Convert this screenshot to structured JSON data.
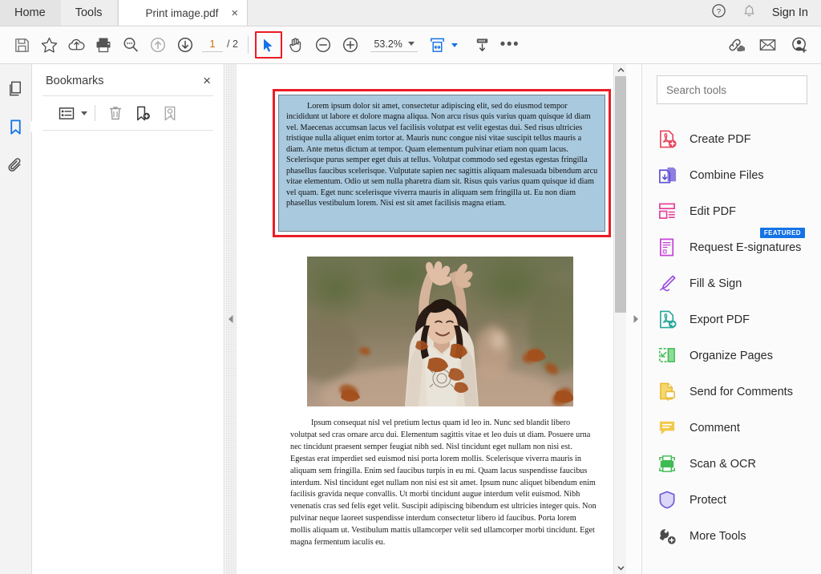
{
  "window": {
    "tabs": [
      {
        "label": "Home",
        "name": "home-tab"
      },
      {
        "label": "Tools",
        "name": "tools-tab"
      }
    ],
    "document_tab": {
      "title": "Print image.pdf",
      "close": "×"
    },
    "sign_in": "Sign In",
    "help_icon": "help-circle-icon",
    "bell_icon": "notification-bell-icon"
  },
  "toolbar": {
    "save_icon": "save-icon",
    "star_icon": "add-to-favorites-star-icon",
    "cloud_icon": "save-to-cloud-icon",
    "print_icon": "print-icon",
    "search_icon": "search-icon",
    "previous_icon": "previous-page-up-arrow-icon",
    "next_icon": "next-page-down-arrow-icon",
    "page_current": "1",
    "page_total": "/ 2",
    "select_tool_icon": "select-cursor-icon",
    "hand_tool_icon": "hand-pan-icon",
    "zoom_out_icon": "zoom-out-minus-icon",
    "zoom_in_icon": "zoom-in-plus-icon",
    "zoom_level": "53.2%",
    "fit_page_icon": "fit-page-width-icon",
    "scroll_mode_icon": "page-display-scroll-icon",
    "more_icon": "more-options-ellipsis-icon",
    "share_link_icon": "share-link-cloud-icon",
    "email_icon": "email-envelope-icon",
    "add_person_icon": "add-person-icon"
  },
  "rail": {
    "items": [
      {
        "name": "page-thumbnails-icon",
        "label": "Page Thumbnails",
        "active": false
      },
      {
        "name": "bookmarks-icon",
        "label": "Bookmarks",
        "active": true
      },
      {
        "name": "attachments-paperclip-icon",
        "label": "Attachments",
        "active": false
      }
    ]
  },
  "bookmarks": {
    "title": "Bookmarks",
    "close_label": "×",
    "tools": [
      {
        "name": "bookmark-options-list-icon",
        "label": "Options"
      },
      {
        "name": "delete-trash-icon",
        "label": "Delete Bookmark"
      },
      {
        "name": "new-bookmark-icon",
        "label": "New Bookmark"
      },
      {
        "name": "find-bookmark-icon",
        "label": "Find Bookmark"
      }
    ]
  },
  "document": {
    "selected_paragraph": "Lorem ipsum dolor sit amet, consectetur adipiscing elit, sed do eiusmod tempor incididunt ut labore et dolore magna aliqua. Non arcu risus quis varius quam quisque id diam vel. Maecenas accumsan lacus vel facilisis volutpat est velit egestas dui. Sed risus ultricies tristique nulla aliquet enim tortor at. Mauris nunc congue nisi vitae suscipit tellus mauris a diam. Ante metus dictum at tempor. Quam elementum pulvinar etiam non quam lacus. Scelerisque purus semper eget duis at tellus. Volutpat commodo sed egestas egestas fringilla phasellus faucibus scelerisque. Vulputate sapien nec sagittis aliquam malesuada bibendum arcu vitae elementum. Odio ut sem nulla pharetra diam sit. Risus quis varius quam quisque id diam vel quam. Eget nunc scelerisque viverra mauris in aliquam sem fringilla ut. Eu non diam phasellus vestibulum lorem. Nisi est sit amet facilisis magna etiam.",
    "body_paragraph": "Ipsum consequat nisl vel pretium lectus quam id leo in. Nunc sed blandit libero volutpat sed cras ornare arcu dui. Elementum sagittis vitae et leo duis ut diam. Posuere urna nec tincidunt praesent semper feugiat nibh sed. Nisl tincidunt eget nullam non nisi est. Egestas erat imperdiet sed euismod nisi porta lorem mollis. Scelerisque viverra mauris in aliquam sem fringilla. Enim sed faucibus turpis in eu mi. Quam lacus suspendisse faucibus interdum. Nisl tincidunt eget nullam non nisi est sit amet. Ipsum nunc aliquet bibendum enim facilisis gravida neque convallis. Ut morbi tincidunt augue interdum velit euismod. Nibh venenatis cras sed felis eget velit. Suscipit adipiscing bibendum est ultricies integer quis. Non pulvinar neque laoreet suspendisse interdum consectetur libero id faucibus. Porta lorem mollis aliquam ut. Vestibulum mattis ullamcorper velit sed ullamcorper morbi tincidunt. Eget magna fermentum iaculis eu.",
    "image_alt": "woman-with-raised-arms-in-autumn-leaves-photo",
    "selection_border_color": "#ec1c24",
    "selection_highlight_color": "#a9c9de"
  },
  "tools_panel": {
    "search_placeholder": "Search tools",
    "items": [
      {
        "label": "Create PDF",
        "icon": "create-pdf-icon",
        "badge": ""
      },
      {
        "label": "Combine Files",
        "icon": "combine-files-icon",
        "badge": ""
      },
      {
        "label": "Edit PDF",
        "icon": "edit-pdf-icon",
        "badge": ""
      },
      {
        "label": "Request E-signatures",
        "icon": "request-e-signatures-icon",
        "badge": "FEATURED"
      },
      {
        "label": "Fill & Sign",
        "icon": "fill-and-sign-icon",
        "badge": ""
      },
      {
        "label": "Export PDF",
        "icon": "export-pdf-icon",
        "badge": ""
      },
      {
        "label": "Organize Pages",
        "icon": "organize-pages-icon",
        "badge": ""
      },
      {
        "label": "Send for Comments",
        "icon": "send-for-comments-icon",
        "badge": ""
      },
      {
        "label": "Comment",
        "icon": "comment-icon",
        "badge": ""
      },
      {
        "label": "Scan & OCR",
        "icon": "scan-and-ocr-icon",
        "badge": ""
      },
      {
        "label": "Protect",
        "icon": "protect-shield-icon",
        "badge": ""
      },
      {
        "label": "More Tools",
        "icon": "more-tools-wrench-icon",
        "badge": ""
      }
    ]
  },
  "scrollbar": {
    "up_arrow": "scroll-up-arrow",
    "down_arrow": "scroll-down-arrow"
  }
}
